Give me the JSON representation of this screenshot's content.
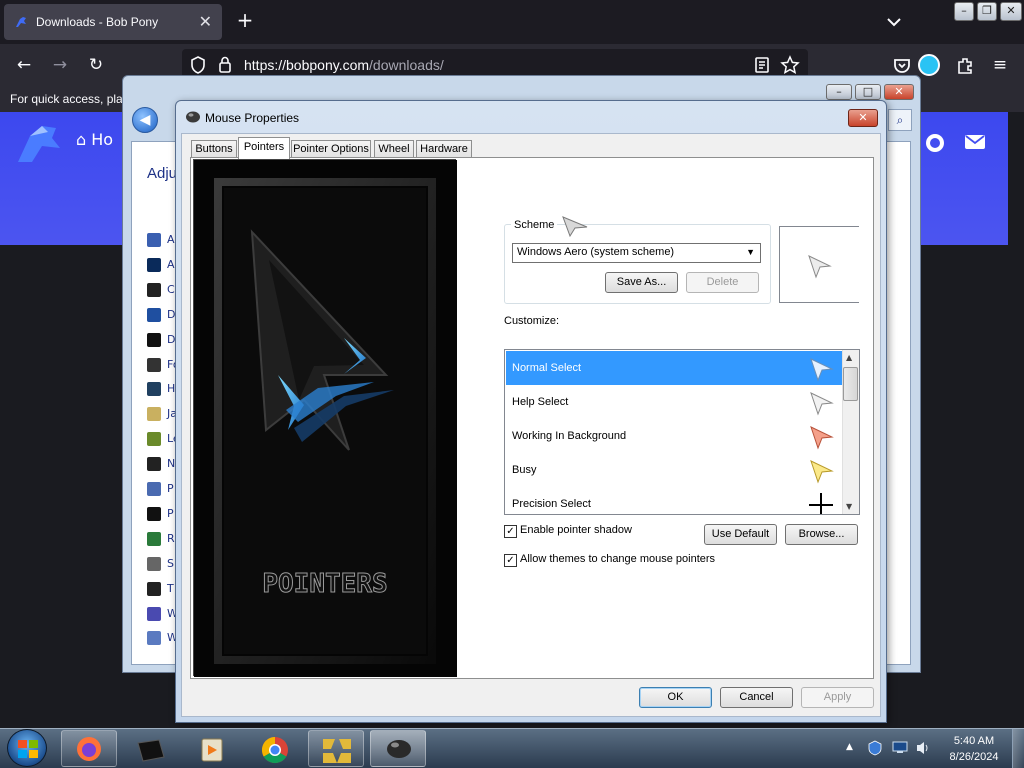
{
  "browser": {
    "tab_title": "Downloads - Bob Pony",
    "url_host": "https://bobpony.com",
    "url_path": "/downloads/",
    "bookmark_hint": "For quick access, plac",
    "site_nav_home": "Ho"
  },
  "control_panel": {
    "heading": "Adju",
    "items": [
      "A",
      "A",
      "C",
      "D",
      "D",
      "Fo",
      "H",
      "Ja",
      "Le",
      "N",
      "P",
      "P",
      "R",
      "Sp",
      "T",
      "W",
      "W"
    ]
  },
  "dialog": {
    "title": "Mouse Properties",
    "tabs": [
      "Buttons",
      "Pointers",
      "Pointer Options",
      "Wheel",
      "Hardware"
    ],
    "active_tab": "Pointers",
    "preview_text": "POINTERS",
    "scheme_label": "Scheme",
    "scheme_value": "Windows Aero (system scheme)",
    "save_as": "Save As...",
    "delete": "Delete",
    "customize_label": "Customize:",
    "cursors": [
      {
        "label": "Normal Select",
        "selected": true
      },
      {
        "label": "Help Select",
        "selected": false
      },
      {
        "label": "Working In Background",
        "selected": false
      },
      {
        "label": "Busy",
        "selected": false
      },
      {
        "label": "Precision Select",
        "selected": false
      }
    ],
    "enable_shadow": "Enable pointer shadow",
    "allow_themes": "Allow themes to change mouse pointers",
    "use_default": "Use Default",
    "browse": "Browse...",
    "ok": "OK",
    "cancel": "Cancel",
    "apply": "Apply"
  },
  "taskbar": {
    "time": "5:40 AM",
    "date": "8/26/2024"
  }
}
